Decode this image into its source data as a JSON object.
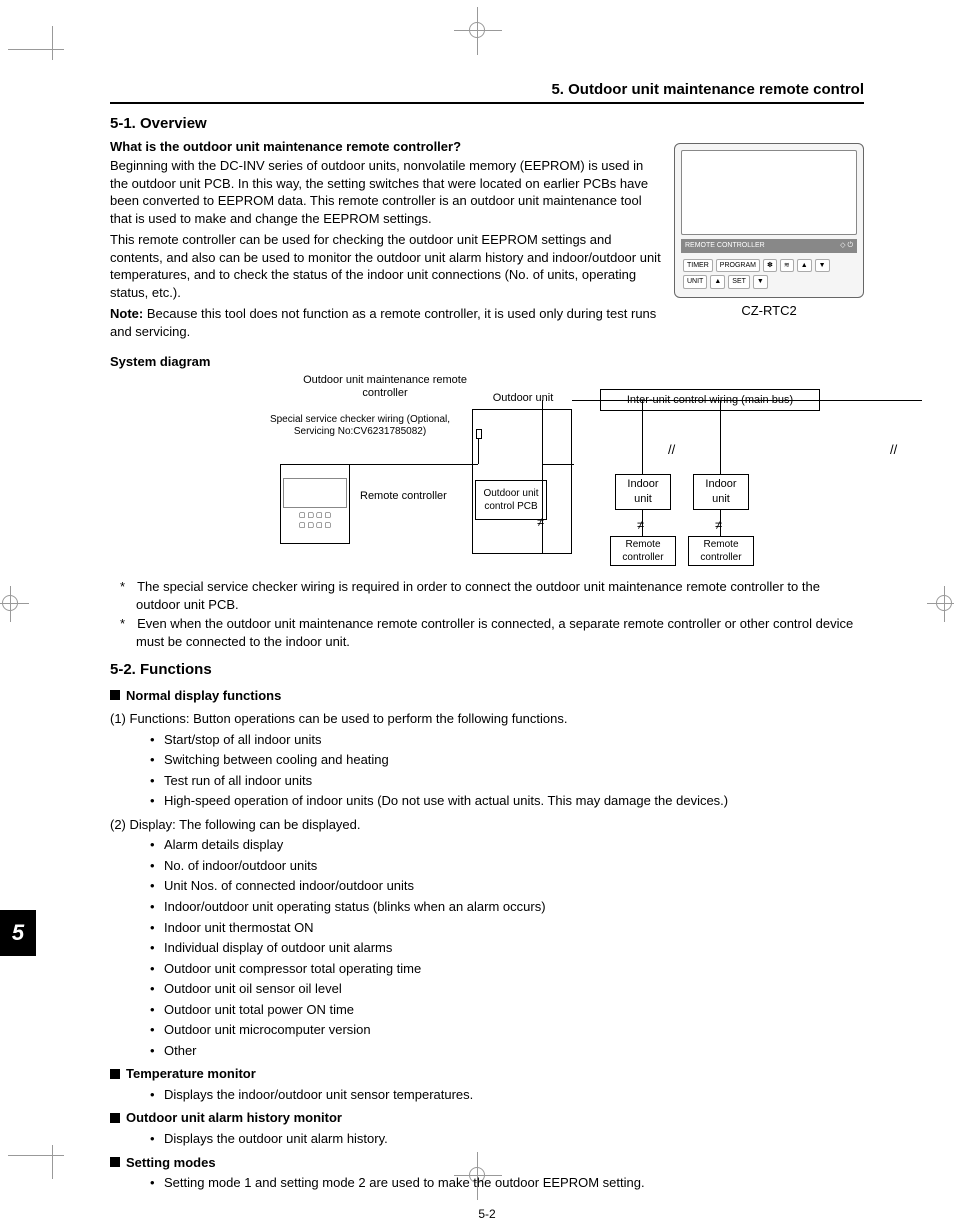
{
  "header": {
    "title": "5. Outdoor unit maintenance remote control"
  },
  "s1": {
    "heading": "5-1. Overview",
    "q": "What is the outdoor unit maintenance remote controller?",
    "p1": "Beginning with the DC-INV series of outdoor units, nonvolatile memory (EEPROM) is used in the outdoor unit PCB. In this way, the setting switches that were located on earlier PCBs have been converted to EEPROM data. This remote controller is an outdoor unit maintenance tool that is used to make and change the EEPROM settings.",
    "p2": "This remote controller can be used for checking the outdoor unit EEPROM settings and contents, and also can be used to monitor the outdoor unit alarm history and indoor/outdoor unit temperatures, and to check the status of the indoor unit connections (No. of units, operating status, etc.).",
    "note_label": "Note:",
    "note": " Because this tool does not function as a remote controller, it is used only during test runs and servicing.",
    "remote_model": "CZ-RTC2",
    "remote_bar": "REMOTE CONTROLLER",
    "remote_btn_program": "PROGRAM",
    "remote_btn_unit": "UNIT",
    "remote_btn_set": "SET",
    "remote_btn_timer": "TIMER"
  },
  "diagram": {
    "title": "System diagram",
    "outdoor_rc_label": "Outdoor unit maintenance\nremote controller",
    "checker_label": "Special service checker wiring\n(Optional, Servicing No:CV6231785082)",
    "remote_controller": "Remote controller",
    "outdoor_unit": "Outdoor unit",
    "outdoor_pcb": "Outdoor unit\ncontrol PCB",
    "interunit": "Inter-unit control wiring (main bus)",
    "indoor_unit": "Indoor\nunit",
    "remote_ctrl_box": "Remote\ncontroller",
    "star1": "The special service checker wiring is required in order to connect the outdoor unit maintenance remote controller to the outdoor unit PCB.",
    "star2": "Even when the outdoor unit maintenance remote controller is connected, a separate remote controller or other control device must be connected to the indoor unit."
  },
  "s2": {
    "heading": "5-2. Functions",
    "sub_normal": "Normal display functions",
    "f1_lead": "(1) Functions: Button operations can be used to perform the following functions.",
    "f1_items": [
      "Start/stop of all indoor units",
      "Switching between cooling and heating",
      "Test run of all indoor units",
      "High-speed operation of indoor units (Do not use with actual units. This may damage the devices.)"
    ],
    "f2_lead": "(2) Display: The following can be displayed.",
    "f2_items": [
      "Alarm details display",
      "No. of indoor/outdoor units",
      "Unit Nos. of connected indoor/outdoor units",
      "Indoor/outdoor unit operating status (blinks when an alarm occurs)",
      "Indoor unit thermostat ON",
      "Individual display of outdoor unit alarms",
      "Outdoor unit compressor total operating time",
      "Outdoor unit oil sensor oil level",
      "Outdoor unit total power ON time",
      "Outdoor unit microcomputer version",
      "Other"
    ],
    "sub_temp": "Temperature monitor",
    "temp_item": "Displays the indoor/outdoor unit sensor temperatures.",
    "sub_alarm": "Outdoor unit alarm history monitor",
    "alarm_item": "Displays the outdoor unit alarm history.",
    "sub_setting": "Setting modes",
    "setting_item": "Setting mode 1 and setting mode 2 are used to make the outdoor EEPROM setting."
  },
  "page": {
    "tab": "5",
    "footer": "5-2"
  }
}
